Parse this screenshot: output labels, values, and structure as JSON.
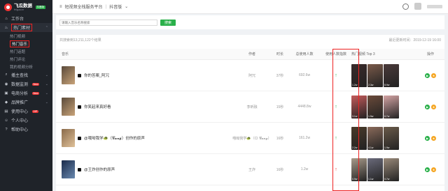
{
  "logo": {
    "title": "飞瓜数据",
    "subtitle": "feigua.cn",
    "badge": "抖音版"
  },
  "sidebar": {
    "workbench": "工作台",
    "hot_material": "热门素材",
    "sub_items": [
      "热门视频",
      "热门音乐",
      "热门话题",
      "热门评论",
      "我的视频分析"
    ],
    "items": [
      {
        "label": "播主查找",
        "badge": ""
      },
      {
        "label": "数据监测",
        "badge": "New"
      },
      {
        "label": "电商分析",
        "badge": "New"
      },
      {
        "label": "品牌推广",
        "badge": ""
      },
      {
        "label": "使用中心",
        "badge": "VIP"
      },
      {
        "label": "个人中心",
        "badge": ""
      },
      {
        "label": "帮助中心",
        "badge": ""
      }
    ]
  },
  "topbar": {
    "crumb1": "短视频全栈服务平台",
    "crumb2": "抖音版"
  },
  "search": {
    "placeholder": "请输入音乐名称搜索",
    "button": "搜索"
  },
  "info": {
    "count": "共搜索到13,211,122个结果",
    "updated": "最近更新时间：2019-12-19 16:00"
  },
  "table": {
    "headers": {
      "music": "音乐",
      "author": "作者",
      "duration": "时长",
      "users": "总使用人数",
      "trend": "使用人数指数",
      "videos": "热门视频 Top 3",
      "ops": "操作"
    },
    "rows": [
      {
        "title": "你的答案_阿冗",
        "author": "阿冗",
        "duration": "37秒",
        "users": "692.6w",
        "trend_up": "↑",
        "trend_color": "green",
        "video_counts": [
          "1.2w",
          "2.3w",
          "8.9w"
        ]
      },
      {
        "title": "你笑起来真好看",
        "author": "李昕融",
        "duration": "15秒",
        "users": "4448.8w",
        "trend_up": "↑",
        "trend_color": "green",
        "video_counts": [
          "3.1w",
          "1.5w",
          "6.7w"
        ]
      },
      {
        "title": "@哦呦我学🐢（𝓒𝓪𝓷𝓰）创作的原声",
        "author": "哦呦我学🐢（CI 𝓒𝓪𝓷𝓰）",
        "duration": "16秒",
        "users": "161.2w",
        "trend_up": "↑",
        "trend_color": "green",
        "video_counts": [
          "2.2w",
          "4.1w",
          "1.9w"
        ]
      },
      {
        "title": "@王炸创作的原声",
        "author": "王炸",
        "duration": "16秒",
        "users": "1.2w",
        "trend_up": "↑",
        "trend_color": "red",
        "video_counts": [
          "0.9w",
          "1.1w",
          "0.7w"
        ]
      }
    ]
  },
  "colors": {
    "accent": "#2ab04a",
    "highlight": "#e22222",
    "sidebar": "#1f2329"
  }
}
